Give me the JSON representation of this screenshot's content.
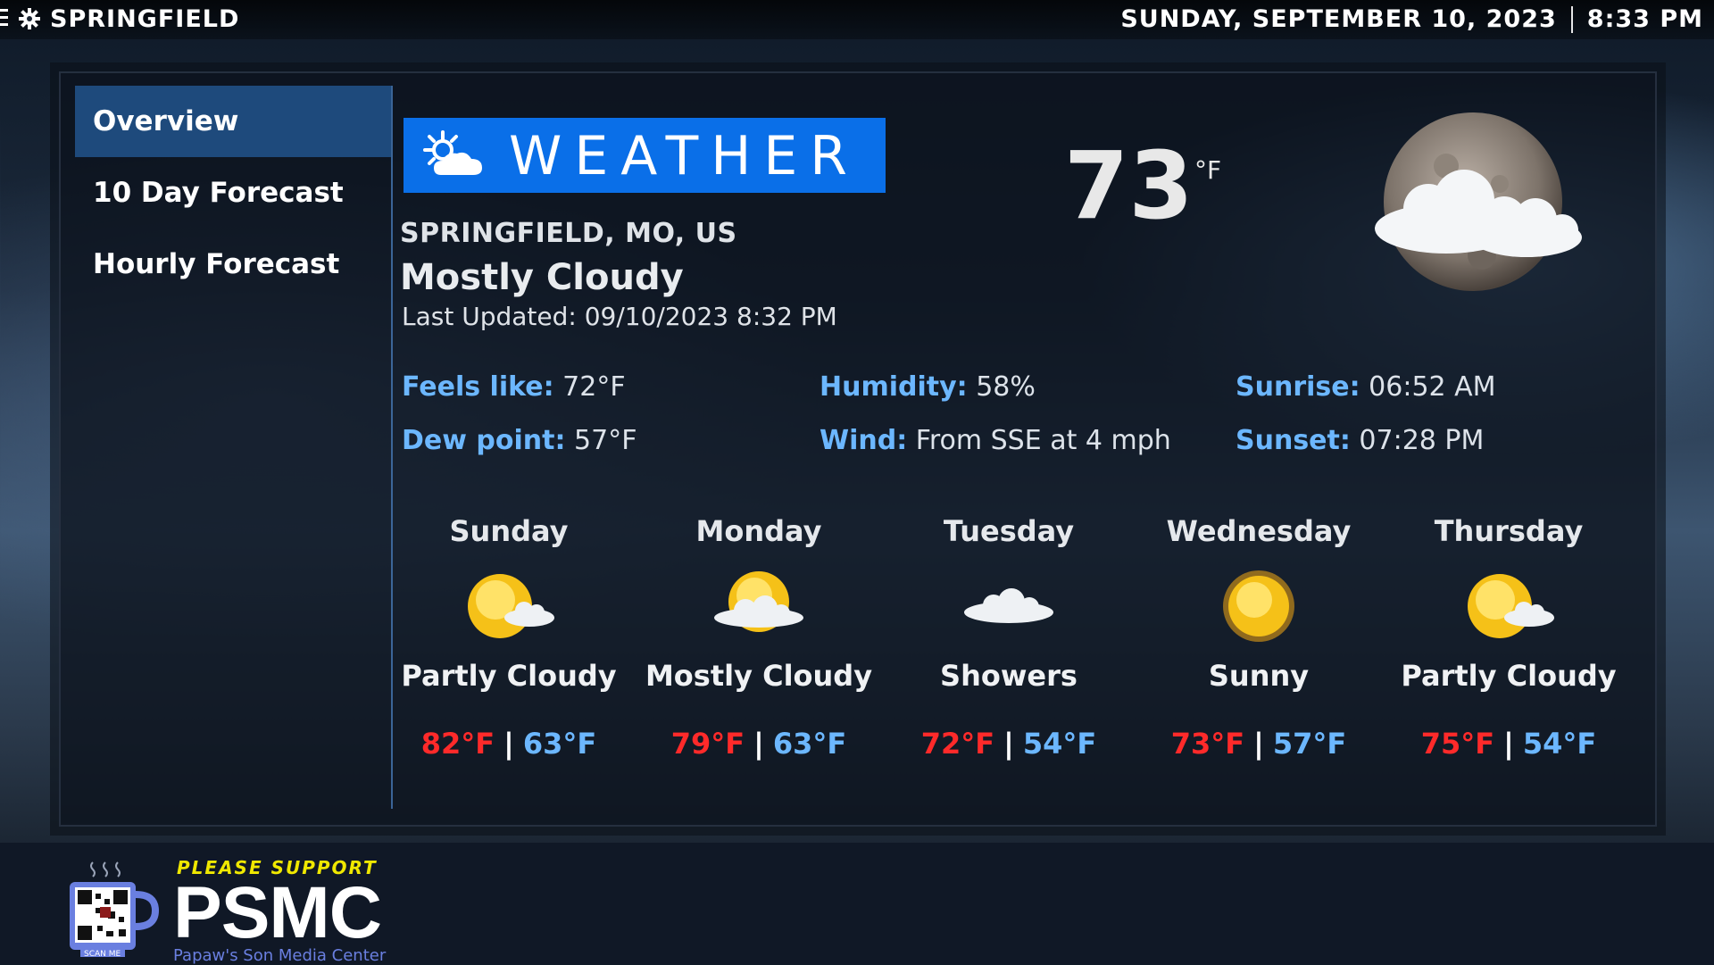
{
  "topbar": {
    "menu_icon": "menu-icon",
    "settings_icon": "gear-icon",
    "city": "SPRINGFIELD",
    "date": "SUNDAY, SEPTEMBER 10, 2023",
    "time": "8:33 PM"
  },
  "sidebar": {
    "items": [
      {
        "label": "Overview",
        "active": true
      },
      {
        "label": "10 Day Forecast",
        "active": false
      },
      {
        "label": "Hourly Forecast",
        "active": false
      }
    ]
  },
  "current": {
    "logo_text": "WEATHER",
    "logo_icon": "sun-cloud-icon",
    "location": "SPRINGFIELD, MO, US",
    "condition": "Mostly Cloudy",
    "updated": "Last Updated: 09/10/2023 8:32 PM",
    "temperature": "73",
    "unit": "°F",
    "icon": "moon-cloud-icon"
  },
  "details": {
    "feels_like": {
      "label": "Feels like:",
      "value": "72°F"
    },
    "dew_point": {
      "label": "Dew point:",
      "value": "57°F"
    },
    "humidity": {
      "label": "Humidity:",
      "value": "58%"
    },
    "wind": {
      "label": "Wind:",
      "value": "From SSE at 4 mph"
    },
    "sunrise": {
      "label": "Sunrise:",
      "value": "06:52 AM"
    },
    "sunset": {
      "label": "Sunset:",
      "value": "07:28 PM"
    }
  },
  "forecast": [
    {
      "day": "Sunday",
      "condition": "Partly Cloudy",
      "high": "82°F",
      "low": "63°F",
      "icon": "partly-cloudy-icon"
    },
    {
      "day": "Monday",
      "condition": "Mostly Cloudy",
      "high": "79°F",
      "low": "63°F",
      "icon": "mostly-cloudy-icon"
    },
    {
      "day": "Tuesday",
      "condition": "Showers",
      "high": "72°F",
      "low": "54°F",
      "icon": "showers-icon"
    },
    {
      "day": "Wednesday",
      "condition": "Sunny",
      "high": "73°F",
      "low": "57°F",
      "icon": "sunny-icon"
    },
    {
      "day": "Thursday",
      "condition": "Partly Cloudy",
      "high": "75°F",
      "low": "54°F",
      "icon": "partly-cloudy-icon"
    }
  ],
  "footer": {
    "support": "PLEASE SUPPORT",
    "brand": "PSMC",
    "subtitle": "Papaw's Son Media Center",
    "qr_caption": "SCAN ME"
  },
  "colors": {
    "accent": "#0a6fe8",
    "label_blue": "#6cb7ff",
    "high_red": "#ff2a2a",
    "sidebar_active": "#1e4a7c",
    "support_yellow": "#f0e800"
  }
}
